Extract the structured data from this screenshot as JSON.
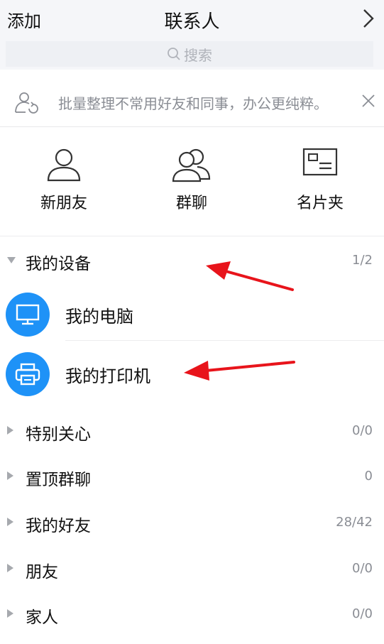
{
  "header": {
    "add_label": "添加",
    "title": "联系人"
  },
  "search": {
    "placeholder": "搜索"
  },
  "tip": {
    "text": "批量整理不常用好友和同事，办公更纯粹。"
  },
  "quick": [
    {
      "label": "新朋友",
      "icon": "person-icon"
    },
    {
      "label": "群聊",
      "icon": "group-icon"
    },
    {
      "label": "名片夹",
      "icon": "card-icon"
    }
  ],
  "device_group": {
    "name": "我的设备",
    "count": "1/2",
    "expanded": true
  },
  "devices": [
    {
      "name": "我的电脑",
      "icon": "monitor-icon"
    },
    {
      "name": "我的打印机",
      "icon": "printer-icon"
    }
  ],
  "groups": [
    {
      "name": "特别关心",
      "count": "0/0"
    },
    {
      "name": "置顶群聊",
      "count": "0"
    },
    {
      "name": "我的好友",
      "count": "28/42"
    },
    {
      "name": "朋友",
      "count": "0/0"
    },
    {
      "name": "家人",
      "count": "0/0"
    }
  ],
  "colors": {
    "accent": "#1e92f7",
    "annotation": "#e8141b"
  }
}
